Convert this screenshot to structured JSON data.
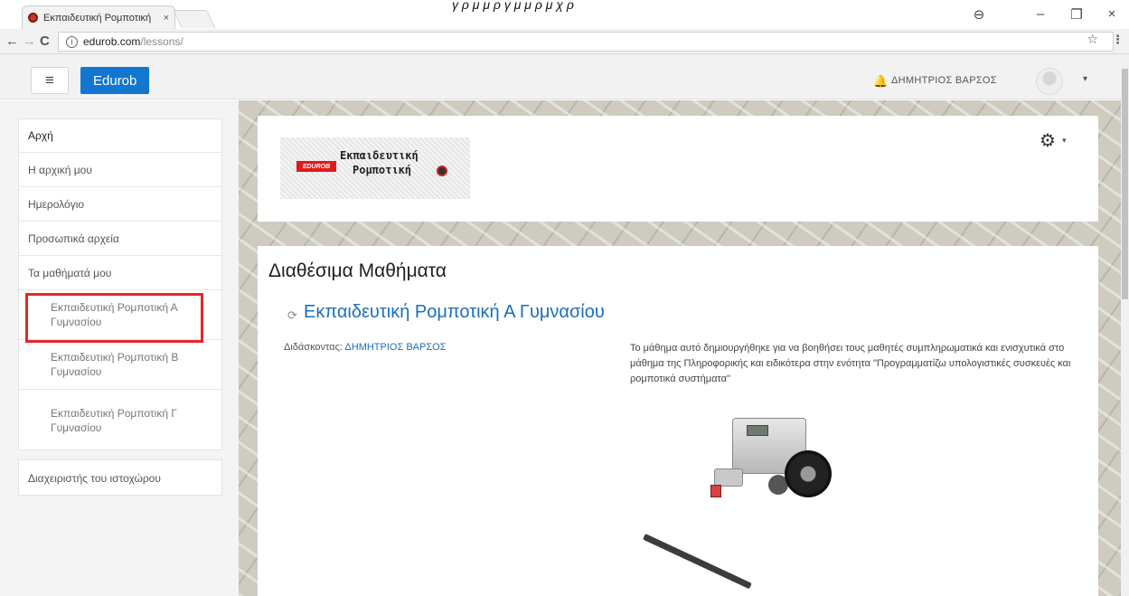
{
  "browser": {
    "tab_title": "Εκπαιδευτική Ρομποτική",
    "tab_close": "×",
    "top_caption": "γ ρ μ μ ρ γ μ μ ρ μ χ ρ",
    "url_domain": "edurob.com",
    "url_path": "/lessons/",
    "win_min": "–",
    "win_max": "❐",
    "win_close": "×",
    "icons": {
      "back": "←",
      "forward": "→",
      "reload": "C",
      "info": "i",
      "star": "☆",
      "menu": "⋮",
      "account": "⊖"
    }
  },
  "navbar": {
    "menu_icon": "≡",
    "brand": "Edurob",
    "bell_icon": "🔔",
    "user_name": "ΔΗΜΗΤΡΙΟΣ ΒΑΡΣΟΣ",
    "caret": "▾"
  },
  "sidebar": {
    "items": [
      {
        "label": "Αρχή"
      },
      {
        "label": "Η αρχική μου"
      },
      {
        "label": "Ημερολόγιο"
      },
      {
        "label": "Προσωπικά αρχεία"
      },
      {
        "label": "Τα μαθήματά μου"
      },
      {
        "label": "Εκπαιδευτική Ρομποτική Α Γυμνασίου"
      },
      {
        "label": "Εκπαιδευτική Ρομποτική Β Γυμνασίου"
      },
      {
        "label": "Εκπαιδευτική Ρομποτική Γ Γυμνασίου"
      }
    ],
    "admin_label": "Διαχειριστής του ιστοχώρου"
  },
  "header": {
    "logo_badge": "EDUROB",
    "logo_line1": "Εκπαιδευτική",
    "logo_line2": "Ρομποτική",
    "gear_icon": "⚙",
    "gear_caret": "▾"
  },
  "main": {
    "title": "Διαθέσιμα Μαθήματα",
    "course_icon": "⟳",
    "course_name": "Εκπαιδευτική Ρομποτική Α Γυμνασίου",
    "teacher_label": "Διδάσκοντας: ",
    "teacher_name": "ΔΗΜΗΤΡΙΟΣ ΒΑΡΣΟΣ",
    "summary": "Το μάθημα αυτό δημιουργήθηκε για να βοηθήσει τους μαθητές συμπληρωματικά και ενισχυτικά στο μάθημα της Πληροφορικής και ειδικότερα στην ενότητα \"Προγραμματίζω υπολογιστικές συσκευές και ρομποτικά συστήματα\""
  }
}
